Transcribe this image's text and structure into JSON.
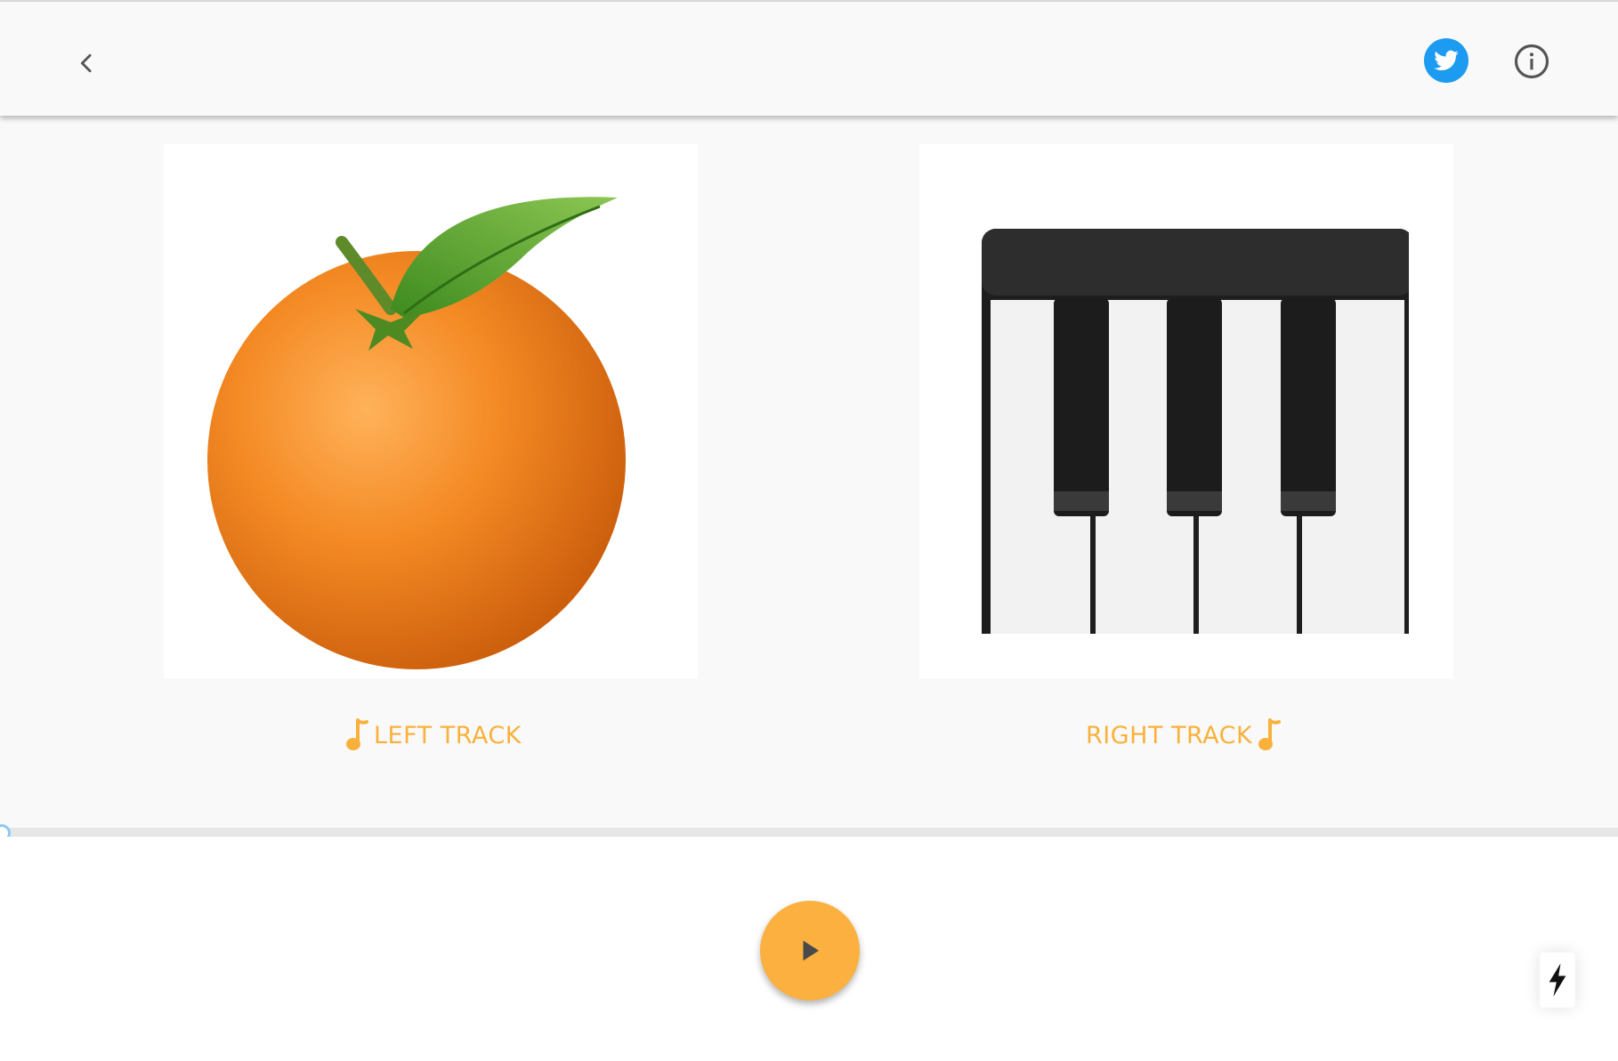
{
  "header": {
    "back_icon": "chevron-left-icon",
    "twitter_icon": "twitter-bird-icon",
    "info_icon": "info-circle-icon",
    "colors": {
      "twitter": "#1d9bf0"
    }
  },
  "tracks": {
    "left": {
      "label": "LEFT TRACK",
      "emoji": "tangerine",
      "icon": "music-note-icon"
    },
    "right": {
      "label": "RIGHT TRACK",
      "emoji": "musical-keyboard",
      "icon": "music-note-icon"
    }
  },
  "player": {
    "play_icon": "play-icon",
    "flash_icon": "lightning-bolt-icon",
    "progress": 0,
    "colors": {
      "accent": "#fbb040"
    }
  }
}
